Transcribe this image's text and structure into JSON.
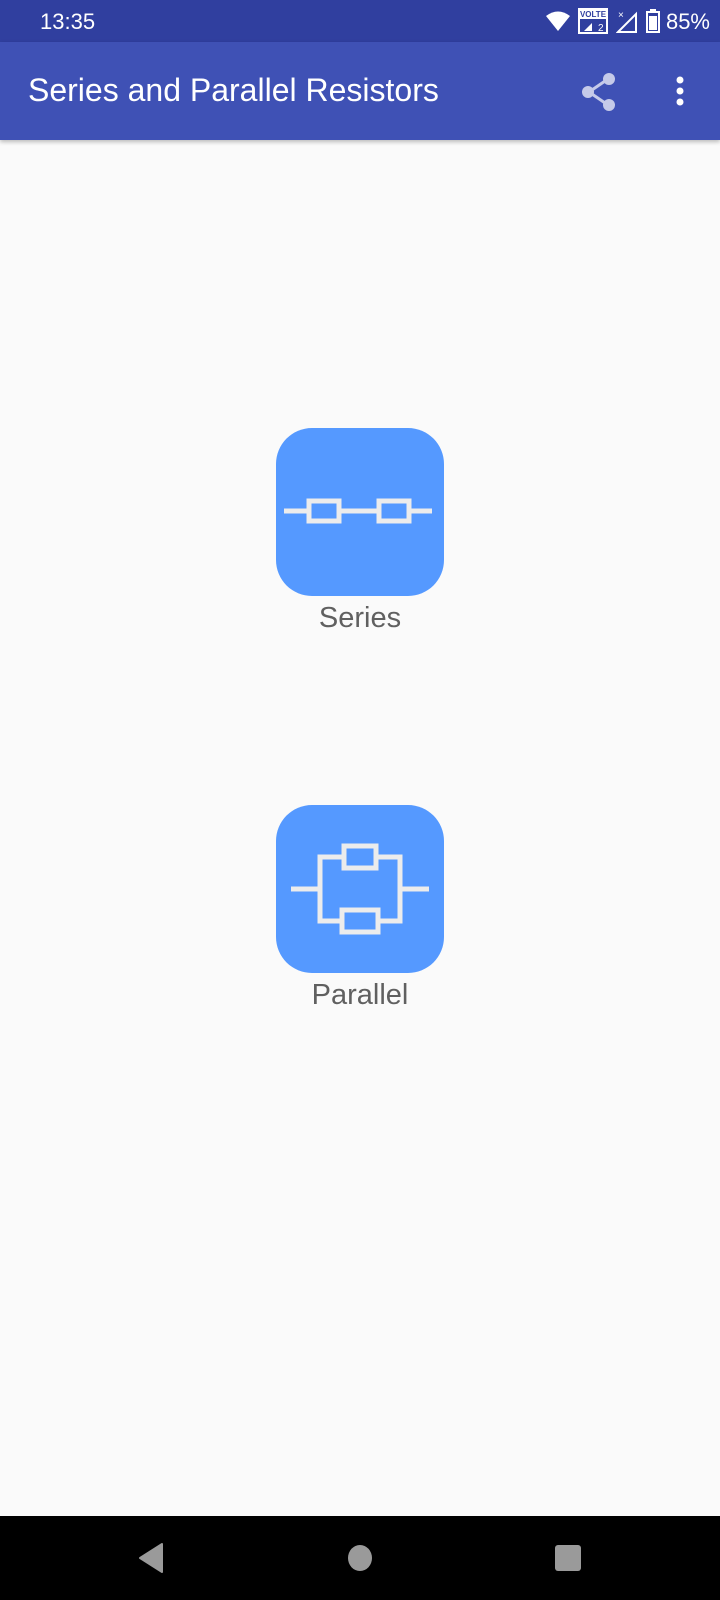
{
  "status_bar": {
    "time": "13:35",
    "battery_percent": "85%",
    "icons": [
      "wifi-icon",
      "volte-icon",
      "signal-icon",
      "battery-icon"
    ],
    "volte_label": "VOLTE",
    "sim_label": "2"
  },
  "app_bar": {
    "title": "Series and Parallel Resistors",
    "actions": [
      "share-icon",
      "more-vert-icon"
    ]
  },
  "main": {
    "options": [
      {
        "label": "Series",
        "icon": "series-circuit-icon"
      },
      {
        "label": "Parallel",
        "icon": "parallel-circuit-icon"
      }
    ]
  },
  "nav_bar": {
    "buttons": [
      "back-icon",
      "home-icon",
      "recents-icon"
    ]
  },
  "colors": {
    "status_bar": "#303f9f",
    "app_bar": "#3f51b5",
    "tile": "#5599ff",
    "background": "#fafafa"
  }
}
